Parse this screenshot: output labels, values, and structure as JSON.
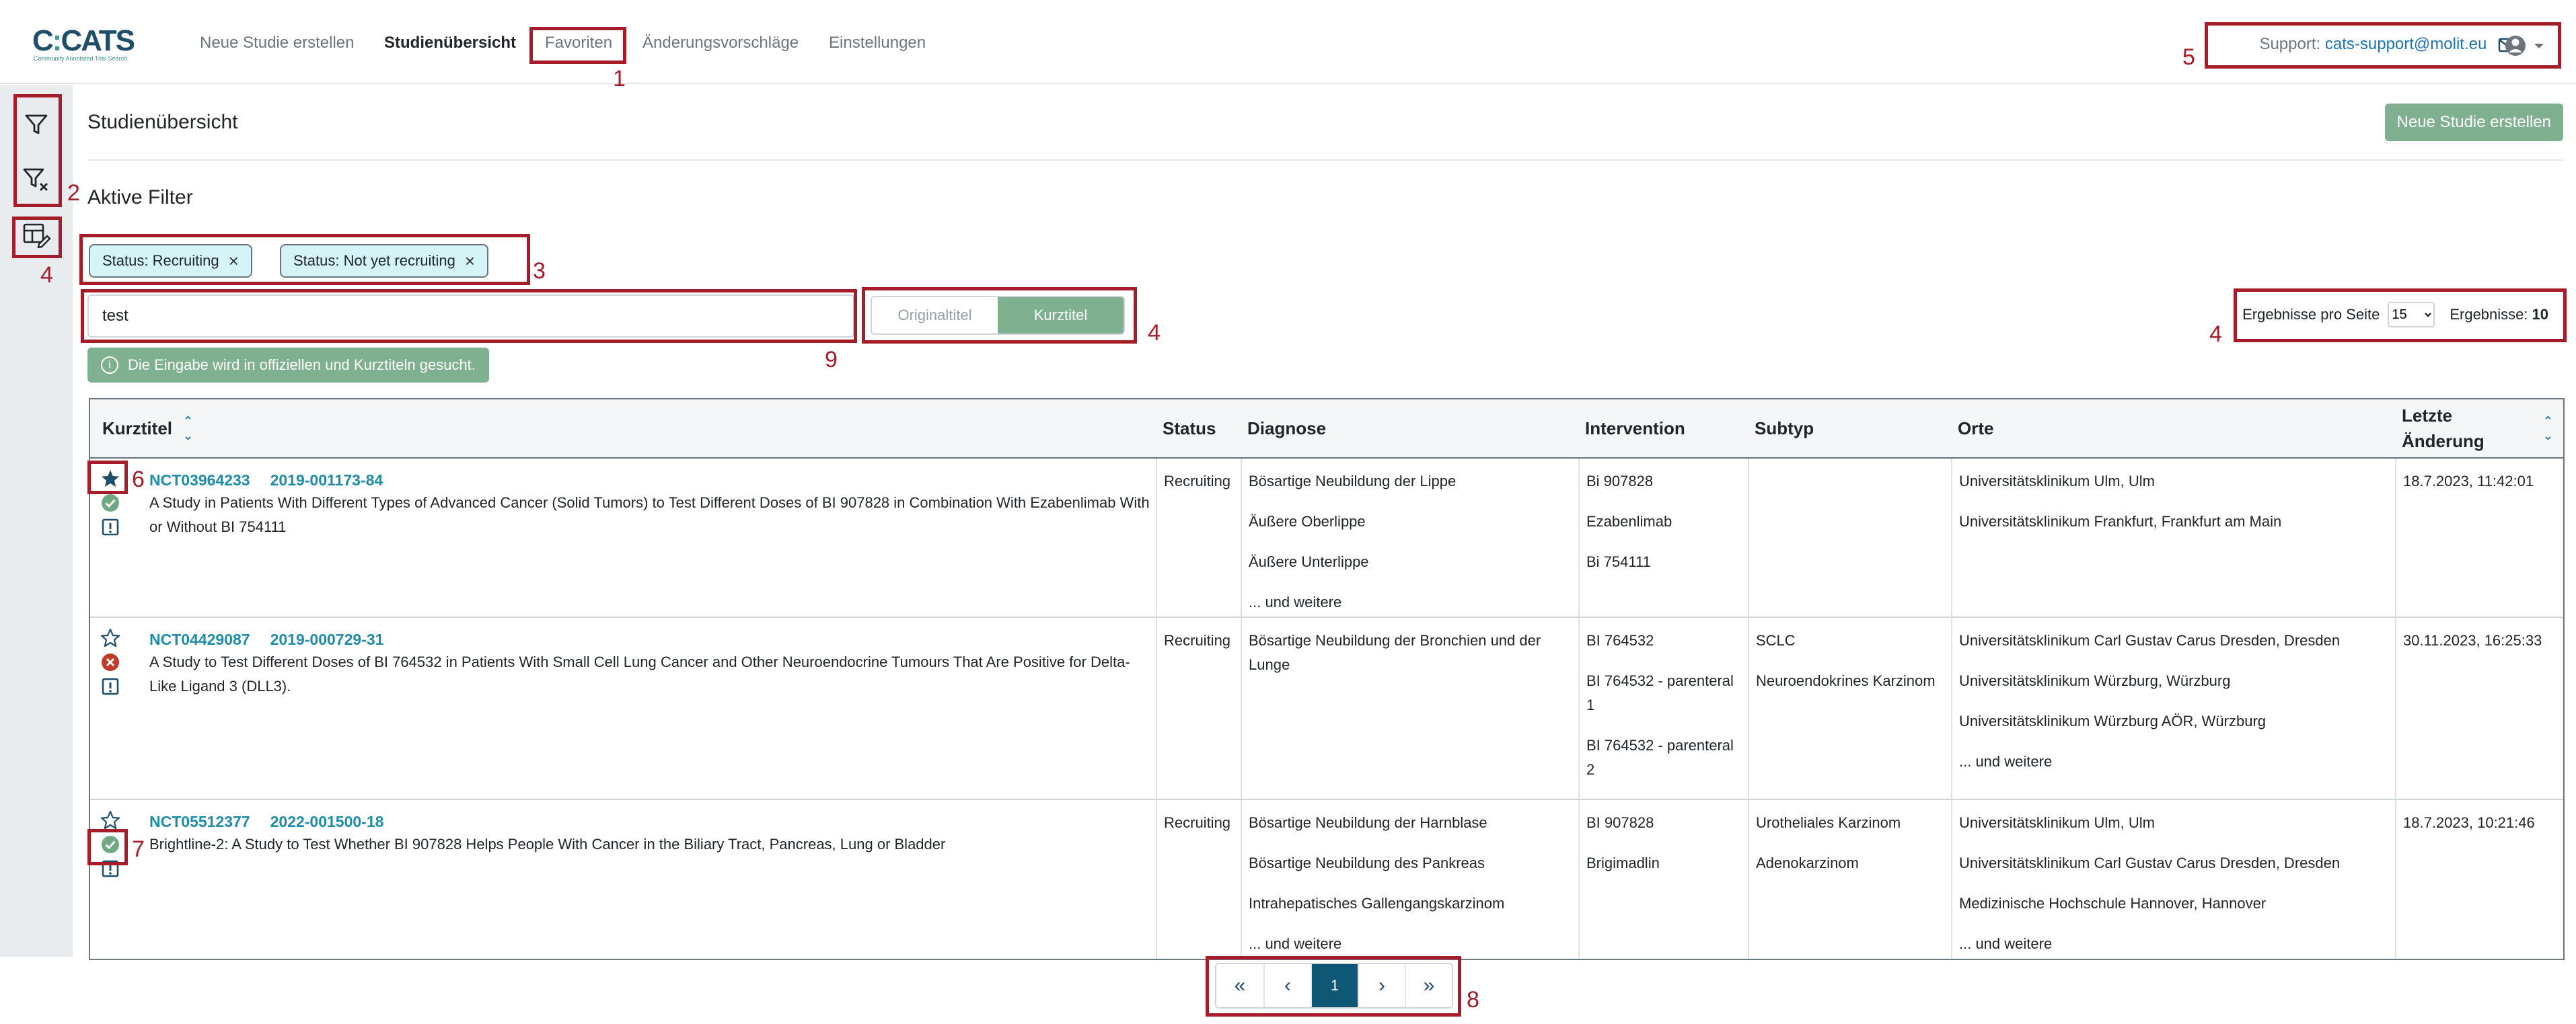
{
  "app": {
    "logo_text": "CATS",
    "logo_tagline": "Community Annotated Trial Search"
  },
  "nav": {
    "items": [
      {
        "label": "Neue Studie erstellen"
      },
      {
        "label": "Studienübersicht",
        "active": true
      },
      {
        "label": "Favoriten"
      },
      {
        "label": "Änderungsvorschläge"
      },
      {
        "label": "Einstellungen"
      }
    ],
    "support_label": "Support:",
    "support_email": "cats-support@molit.eu"
  },
  "page": {
    "title": "Studienübersicht",
    "new_study_button": "Neue Studie erstellen",
    "active_filters_title": "Aktive Filter",
    "filters": [
      {
        "label": "Status: Recruiting"
      },
      {
        "label": "Status: Not yet recruiting"
      }
    ],
    "search": {
      "value": "test",
      "note": "Die Eingabe wird in offiziellen und Kurztiteln gesucht."
    },
    "title_toggle": {
      "options": [
        "Originaltitel",
        "Kurztitel"
      ],
      "selected": "Kurztitel"
    },
    "results_per_page_label": "Ergebnisse pro Seite",
    "results_per_page_value": "15",
    "results_label": "Ergebnisse:",
    "results_count": "10"
  },
  "table": {
    "columns": {
      "title": "Kurztitel",
      "status": "Status",
      "diagnosis": "Diagnose",
      "intervention": "Intervention",
      "subtype": "Subtyp",
      "locations": "Orte",
      "last_change": "Letzte Änderung"
    },
    "rows": [
      {
        "favorite": true,
        "state": "approved",
        "nct": "NCT03964233",
        "eudract": "2019-001173-84",
        "title": "A Study in Patients With Different Types of Advanced Cancer (Solid Tumors) to Test Different Doses of BI 907828 in Combination With Ezabenlimab With or Without BI 754111",
        "status": "Recruiting",
        "diagnosis": [
          "Bösartige Neubildung der Lippe",
          "Äußere Oberlippe",
          "Äußere Unterlippe",
          "... und weitere"
        ],
        "intervention": [
          "Bi 907828",
          "Ezabenlimab",
          "Bi 754111"
        ],
        "subtype": [],
        "locations": [
          "Universitätsklinikum Ulm, Ulm",
          "Universitätsklinikum Frankfurt, Frankfurt am Main"
        ],
        "last_change": "18.7.2023, 11:42:01"
      },
      {
        "favorite": false,
        "state": "rejected",
        "nct": "NCT04429087",
        "eudract": "2019-000729-31",
        "title": "A Study to Test Different Doses of BI 764532 in Patients With Small Cell Lung Cancer and Other Neuroendocrine Tumours That Are Positive for Delta-Like Ligand 3 (DLL3).",
        "status": "Recruiting",
        "diagnosis": [
          "Bösartige Neubildung der Bronchien und der Lunge"
        ],
        "intervention": [
          "BI 764532",
          "BI 764532 - parenteral 1",
          "BI 764532 - parenteral 2"
        ],
        "subtype": [
          "SCLC",
          "Neuroendokrines Karzinom"
        ],
        "locations": [
          "Universitätsklinikum Carl Gustav Carus Dresden, Dresden",
          "Universitätsklinikum Würzburg, Würzburg",
          "Universitätsklinikum Würzburg AÖR, Würzburg",
          "... und weitere"
        ],
        "last_change": "30.11.2023, 16:25:33"
      },
      {
        "favorite": false,
        "state": "approved",
        "nct": "NCT05512377",
        "eudract": "2022-001500-18",
        "title": "Brightline-2: A Study to Test Whether BI 907828 Helps People With Cancer in the Biliary Tract, Pancreas, Lung or Bladder",
        "status": "Recruiting",
        "diagnosis": [
          "Bösartige Neubildung der Harnblase",
          "Bösartige Neubildung des Pankreas",
          "Intrahepatisches Gallengangskarzinom",
          "... und weitere"
        ],
        "intervention": [
          "BI 907828",
          "Brigimadlin"
        ],
        "subtype": [
          "Urotheliales Karzinom",
          "Adenokarzinom"
        ],
        "locations": [
          "Universitätsklinikum Ulm, Ulm",
          "Universitätsklinikum Carl Gustav Carus Dresden, Dresden",
          "Medizinische Hochschule Hannover, Hannover",
          "... und weitere"
        ],
        "last_change": "18.7.2023, 10:21:46"
      }
    ]
  },
  "pagination": {
    "first": "«",
    "prev": "‹",
    "current": "1",
    "next": "›",
    "last": "»"
  },
  "annotations": [
    "1",
    "2",
    "3",
    "4",
    "4",
    "4",
    "5",
    "6",
    "7",
    "8",
    "9"
  ],
  "colors": {
    "accent_green": "#7fb08f",
    "link_teal": "#1f8da8",
    "annotation_red": "#a61c28",
    "active_page": "#0f5875",
    "chip_bg": "#d4f4f7"
  }
}
